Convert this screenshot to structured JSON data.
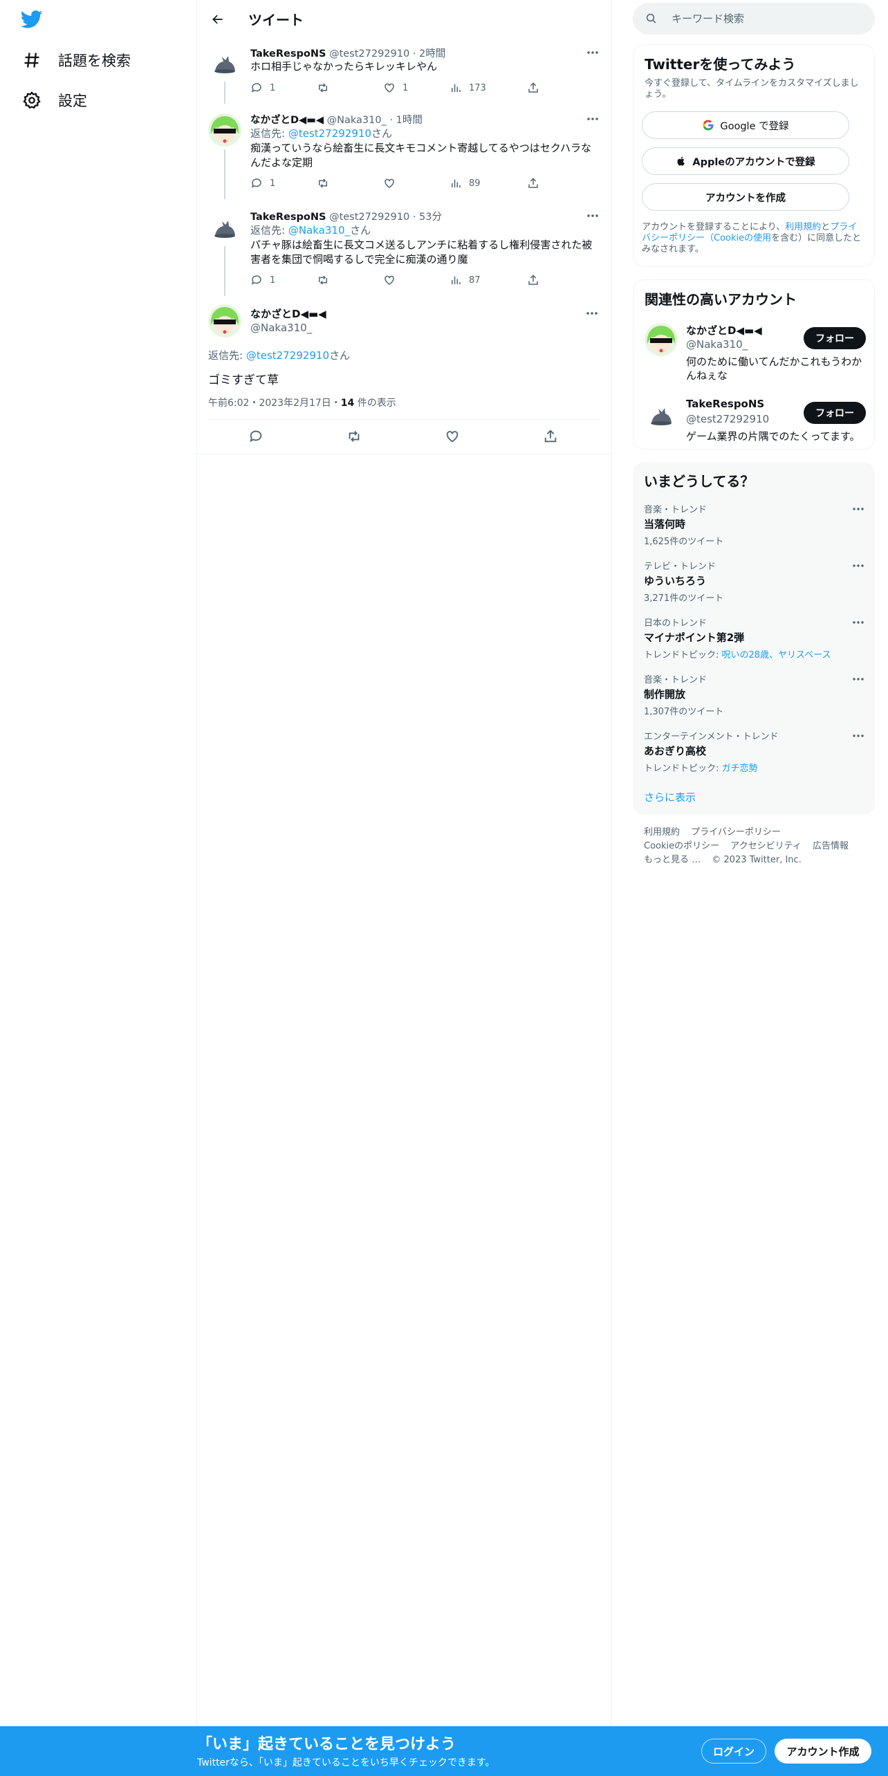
{
  "nav": {
    "logo_icon": "twitter-bird-icon",
    "explore_label": "話題を検索",
    "settings_label": "設定"
  },
  "main": {
    "title": "ツイート",
    "thread": [
      {
        "name": "TakeRespoNS",
        "handle": "@test27292910",
        "time": "2時間",
        "reply_prefix": "",
        "reply_to": "",
        "reply_suffix": "",
        "text": "ホロ相手じゃなかったらキレッキレやん",
        "replies": "1",
        "likes": "1",
        "views": "173"
      },
      {
        "name": "なかざとD◀▬◀",
        "handle": "@Naka310_",
        "time": "1時間",
        "reply_prefix": "返信先: ",
        "reply_to": "@test27292910",
        "reply_suffix": "さん",
        "text": "痴漢っていうなら絵畜生に長文キモコメント寄越してるやつはセクハラなんだよな定期",
        "replies": "1",
        "likes": "",
        "views": "89"
      },
      {
        "name": "TakeRespoNS",
        "handle": "@test27292910",
        "time": "53分",
        "reply_prefix": "返信先: ",
        "reply_to": "@Naka310_",
        "reply_suffix": "さん",
        "text": "パチャ豚は絵畜生に長文コメ送るしアンチに粘着するし権利侵害された被害者を集団で恫喝するしで完全に痴漢の通り魔",
        "replies": "1",
        "likes": "",
        "views": "87"
      }
    ],
    "focus": {
      "name": "なかざとD◀▬◀",
      "handle": "@Naka310_",
      "reply_prefix": "返信先: ",
      "reply_to": "@test27292910",
      "reply_suffix": "さん",
      "text": "ゴミすぎて草",
      "timestamp": "午前6:02・2023年2月17日・",
      "views_count": "14",
      "views_label": " 件の表示"
    }
  },
  "right": {
    "search_placeholder": "キーワード検索",
    "signup_card": {
      "title": "Twitterを使ってみよう",
      "subtitle": "今すぐ登録して、タイムラインをカスタマイズしましょう。",
      "google_label": "Google で登録",
      "apple_label": "Appleのアカウントで登録",
      "create_label": "アカウントを作成",
      "terms_1": "アカウントを登録することにより、",
      "terms_link_1": "利用規約",
      "terms_2": "と",
      "terms_link_2": "プライバシーポリシー（Cookieの使用",
      "terms_3": "を含む）に同意したとみなされます。"
    },
    "related": {
      "title": "関連性の高いアカウント",
      "follow_label": "フォロー",
      "accounts": [
        {
          "name": "なかざとD◀▬◀",
          "handle": "@Naka310_",
          "bio": "何のために働いてんだかこれもうわかんねぇな"
        },
        {
          "name": "TakeRespoNS",
          "handle": "@test27292910",
          "bio": "ゲーム業界の片隅でのたくってます。"
        }
      ]
    },
    "trends": {
      "title": "いまどうしてる？",
      "items": [
        {
          "context": "音楽・トレンド",
          "name": "当落何時",
          "extra": "1,625件のツイート",
          "extra_link": ""
        },
        {
          "context": "テレビ・トレンド",
          "name": "ゆういちろう",
          "extra": "3,271件のツイート",
          "extra_link": ""
        },
        {
          "context": "日本のトレンド",
          "name": "マイナポイント第2弾",
          "extra": "トレンドトピック: ",
          "extra_link": "呪いの28歳、ヤリスベース"
        },
        {
          "context": "音楽・トレンド",
          "name": "制作開放",
          "extra": "1,307件のツイート",
          "extra_link": ""
        },
        {
          "context": "エンターテインメント・トレンド",
          "name": "あおぎり高校",
          "extra": "トレンドトピック: ",
          "extra_link": "ガチ恋勢"
        }
      ],
      "show_more": "さらに表示"
    },
    "footer": {
      "links": [
        "利用規約",
        "プライバシーポリシー",
        "Cookieのポリシー",
        "アクセシビリティ",
        "広告情報",
        "もっと見る …",
        "© 2023 Twitter, Inc."
      ]
    }
  },
  "bottom_bar": {
    "title": "「いま」起きていることを見つけよう",
    "subtitle": "Twitterなら、「いま」起きていることをいち早くチェックできます。",
    "login_label": "ログイン",
    "signup_label": "アカウント作成"
  },
  "colors": {
    "accent": "#1d9bf0",
    "text": "#0f1419",
    "muted": "#536471"
  }
}
